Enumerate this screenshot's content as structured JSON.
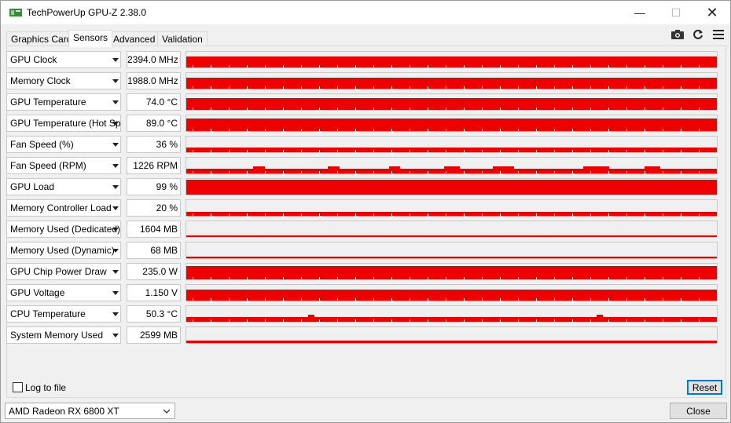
{
  "window": {
    "title": "TechPowerUp GPU-Z 2.38.0",
    "controls": {
      "minimize": "—",
      "maximize": "☐",
      "close": "✕"
    }
  },
  "tabs": [
    {
      "label": "Graphics Card",
      "active": false
    },
    {
      "label": "Sensors",
      "active": true
    },
    {
      "label": "Advanced",
      "active": false
    },
    {
      "label": "Validation",
      "active": false
    }
  ],
  "toolbar": {
    "icons": [
      "camera-icon",
      "refresh-icon",
      "menu-icon"
    ]
  },
  "sensors": [
    {
      "name": "GPU Clock",
      "value": "2394.0 MHz",
      "level": 0.72
    },
    {
      "name": "Memory Clock",
      "value": "1988.0 MHz",
      "level": 0.72
    },
    {
      "name": "GPU Temperature",
      "value": "74.0 °C",
      "level": 0.74
    },
    {
      "name": "GPU Temperature (Hot Spot)",
      "value": "89.0 °C",
      "level": 0.78
    },
    {
      "name": "Fan Speed (%)",
      "value": "36 %",
      "level": 0.3
    },
    {
      "name": "Fan Speed (RPM)",
      "value": "1226 RPM",
      "level": 0.32
    },
    {
      "name": "GPU Load",
      "value": "99 %",
      "level": 0.95
    },
    {
      "name": "Memory Controller Load",
      "value": "20 %",
      "level": 0.25
    },
    {
      "name": "Memory Used (Dedicated)",
      "value": "1604 MB",
      "level": 0.1
    },
    {
      "name": "Memory Used (Dynamic)",
      "value": "68 MB",
      "level": 0.0
    },
    {
      "name": "GPU Chip Power Draw",
      "value": "235.0 W",
      "level": 0.85
    },
    {
      "name": "GPU Voltage",
      "value": "1.150 V",
      "level": 0.7
    },
    {
      "name": "CPU Temperature",
      "value": "50.3 °C",
      "level": 0.3
    },
    {
      "name": "System Memory Used",
      "value": "2599 MB",
      "level": 0.15
    }
  ],
  "footer": {
    "log_label": "Log to file",
    "log_checked": false,
    "reset_label": "Reset",
    "gpu_selected": "AMD Radeon RX 6800 XT",
    "close_label": "Close"
  },
  "colors": {
    "graph": "#ee0000",
    "accent": "#0078d7"
  }
}
